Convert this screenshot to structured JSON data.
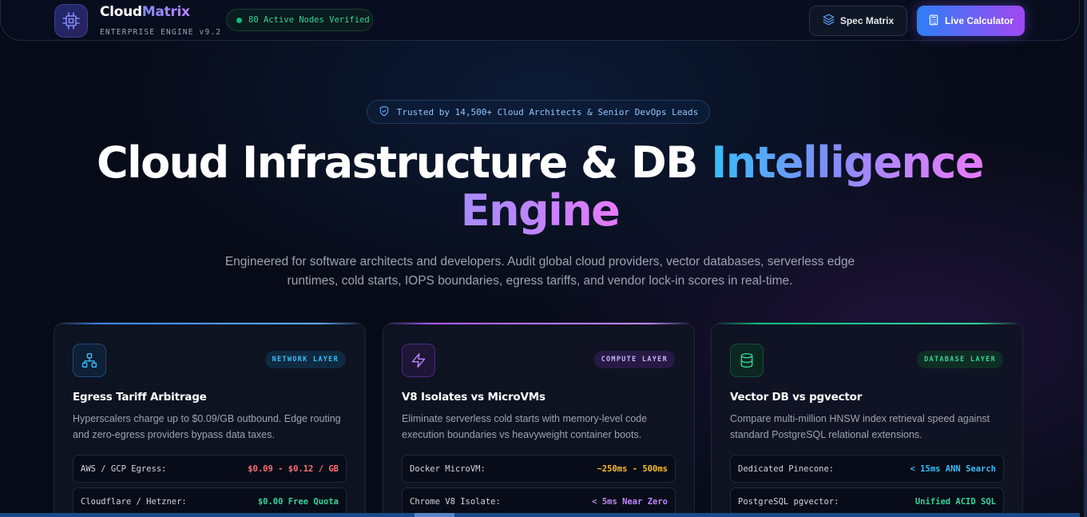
{
  "nav": {
    "brand_main": "Cloud",
    "brand_accent": "Matrix",
    "brand_sub": "ENTERPRISE ENGINE v9.2",
    "status": "80 Active Nodes Verified",
    "spec_button": "Spec Matrix",
    "calc_button": "Live Calculator"
  },
  "hero": {
    "trust": "Trusted by 14,500+ Cloud Architects & Senior DevOps Leads",
    "title_plain": "Cloud Infrastructure & DB ",
    "title_grad": "Intelligence",
    "title_grad2": "Engine",
    "subtitle": "Engineered for software architects and developers. Audit global cloud providers, vector databases, serverless edge runtimes, cold starts, IOPS boundaries, egress tariffs, and vendor lock-in scores in real-time."
  },
  "cards": [
    {
      "badge": "NETWORK LAYER",
      "title": "Egress Tariff Arbitrage",
      "desc": "Hyperscalers charge up to $0.09/GB outbound. Edge routing and zero-egress providers bypass data taxes.",
      "rows": [
        {
          "label": "AWS / GCP Egress:",
          "value": "$0.09 - $0.12 / GB"
        },
        {
          "label": "Cloudflare / Hetzner:",
          "value": "$0.00 Free Quota"
        }
      ]
    },
    {
      "badge": "COMPUTE LAYER",
      "title": "V8 Isolates vs MicroVMs",
      "desc": "Eliminate serverless cold starts with memory-level code execution boundaries vs heavyweight container boots.",
      "rows": [
        {
          "label": "Docker MicroVM:",
          "value": "~250ms - 500ms"
        },
        {
          "label": "Chrome V8 Isolate:",
          "value": "< 5ms Near Zero"
        }
      ]
    },
    {
      "badge": "DATABASE LAYER",
      "title": "Vector DB vs pgvector",
      "desc": "Compare multi-million HNSW index retrieval speed against standard PostgreSQL relational extensions.",
      "rows": [
        {
          "label": "Dedicated Pinecone:",
          "value": "< 15ms ANN Search"
        },
        {
          "label": "PostgreSQL pgvector:",
          "value": "Unified ACID SQL"
        }
      ]
    }
  ],
  "colors": {
    "accent_blue": "#3b82f6",
    "accent_purple": "#a855f7",
    "accent_green": "#10b981"
  }
}
